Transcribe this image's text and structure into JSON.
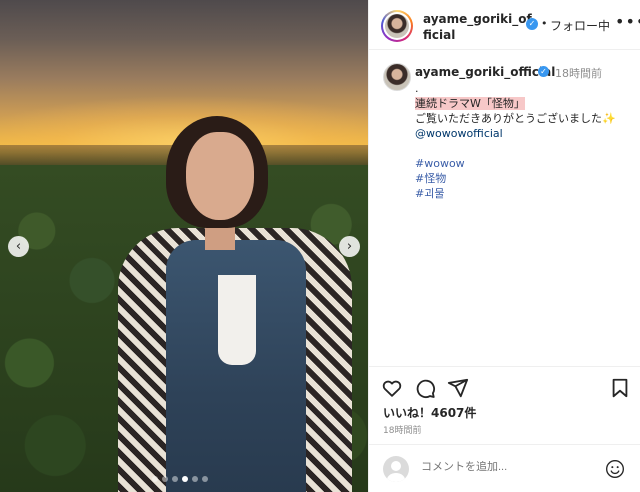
{
  "photo": {
    "prev_button": "‹",
    "next_button": "›",
    "carousel_dots": 6,
    "active_dot_index": 3
  },
  "header": {
    "username": "ayame_goriki_official",
    "separator": "•",
    "follow_label": "フォロー中",
    "more_label": "•••"
  },
  "caption": {
    "username": "ayame_goriki_official",
    "time": "18時間前",
    "lines": {
      "dot": ".",
      "title": "連続ドラマW「怪物」",
      "thanks": "ご覧いただきありがとうございました✨",
      "mention": "@wowowofficial",
      "tag1": "#wowow",
      "tag2": "#怪物",
      "tag3": "#괴물"
    }
  },
  "actions": {
    "likes": "いいね！4607件",
    "time": "18時間前"
  },
  "comment": {
    "placeholder": "コメントを追加..."
  },
  "colors": {
    "verified": "#3897f0",
    "highlight": "#f7c8c8",
    "hashtag": "#3b5ea8"
  },
  "icons": [
    "heart-icon",
    "comment-icon",
    "share-icon",
    "bookmark-icon",
    "emoji-icon",
    "verified-icon",
    "more-icon"
  ]
}
